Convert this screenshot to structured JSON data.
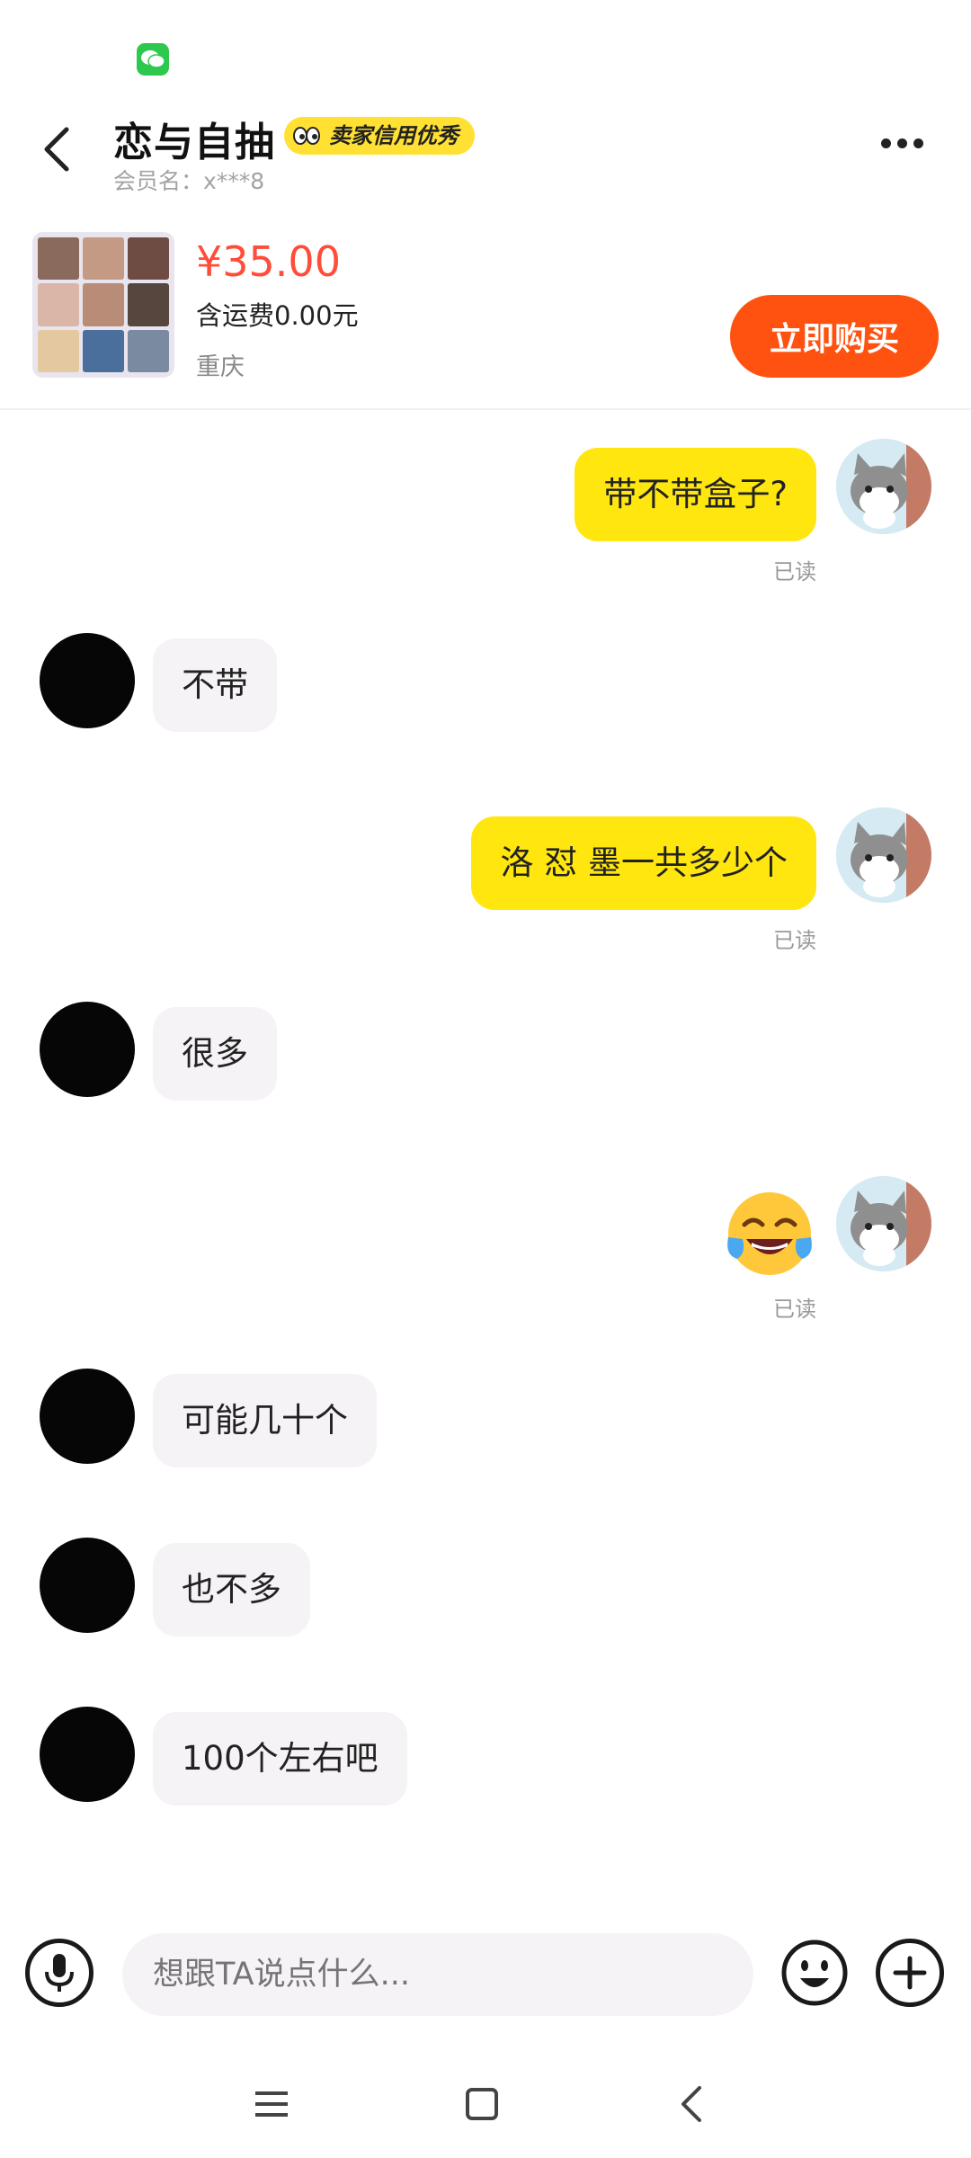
{
  "status_bar": {
    "app_icon": "wechat-icon"
  },
  "header": {
    "title": "恋与自抽",
    "credit_badge": "卖家信用优秀",
    "member_name": "会员名：x***8",
    "back_icon": "chevron-left-icon",
    "more_icon": "more-horizontal-icon"
  },
  "product": {
    "price": "¥35.00",
    "shipping": "含运费0.00元",
    "location": "重庆",
    "buy_label": "立即购买"
  },
  "messages": [
    {
      "from": "me",
      "text": "带不带盒子?",
      "status": "已读"
    },
    {
      "from": "them",
      "text": "不带"
    },
    {
      "from": "me",
      "text": "洛 怼 墨一共多少个",
      "status": "已读"
    },
    {
      "from": "them",
      "text": "很多"
    },
    {
      "from": "me",
      "text": "",
      "emoji": "tears-of-joy-emoji",
      "status": "已读"
    },
    {
      "from": "them",
      "text": "可能几十个"
    },
    {
      "from": "them",
      "text": "也不多"
    },
    {
      "from": "them",
      "text": "100个左右吧"
    }
  ],
  "input_bar": {
    "placeholder": "想跟TA说点什么...",
    "voice_icon": "microphone-icon",
    "emoji_icon": "smile-icon",
    "plus_icon": "plus-icon"
  },
  "nav_bar": {
    "icons": [
      "menu-icon",
      "home-square-icon",
      "back-icon"
    ]
  },
  "colors": {
    "accent_yellow": "#ffe60f",
    "buy_orange": "#ff5210",
    "price_red": "#ff4d3a",
    "bubble_gray": "#f6f3f6"
  }
}
